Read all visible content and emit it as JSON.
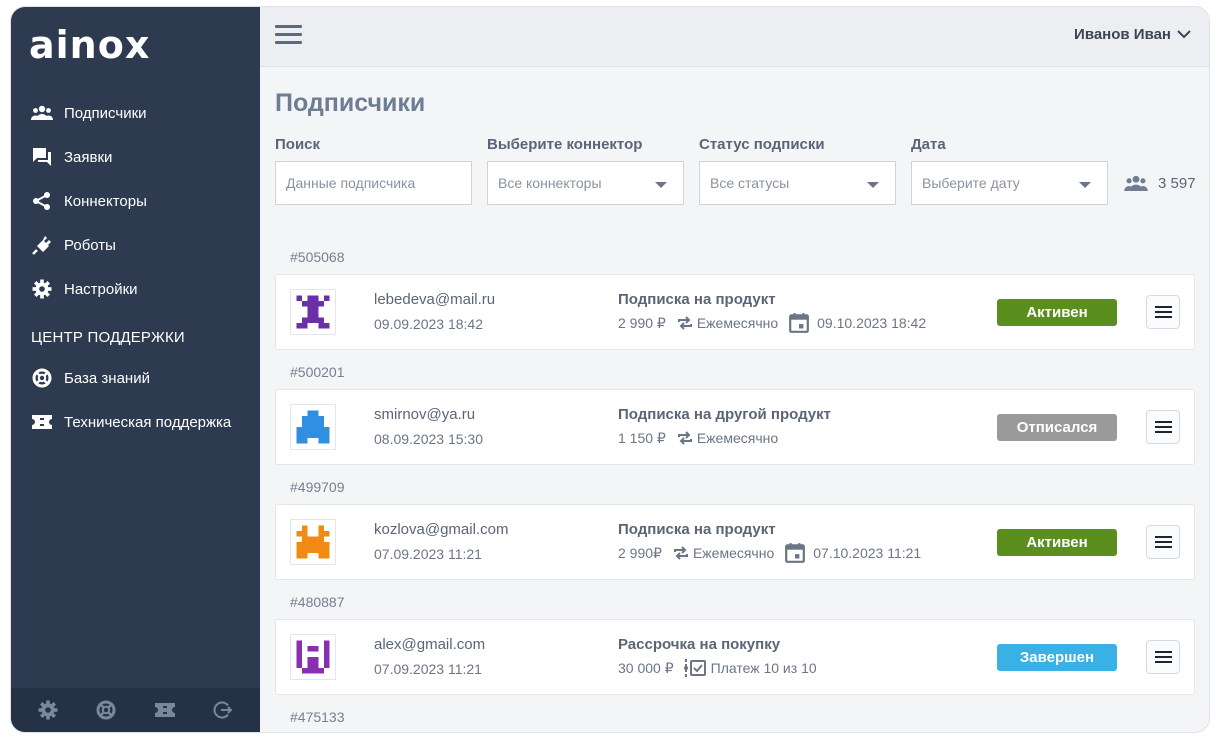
{
  "app": {
    "logo_text": "ainox"
  },
  "sidebar": {
    "items": [
      {
        "label": "Подписчики",
        "icon": "users-icon"
      },
      {
        "label": "Заявки",
        "icon": "chat-icon"
      },
      {
        "label": "Коннекторы",
        "icon": "share-icon"
      },
      {
        "label": "Роботы",
        "icon": "plug-icon"
      },
      {
        "label": "Настройки",
        "icon": "gear-icon"
      }
    ],
    "section_title": "ЦЕНТР ПОДДЕРЖКИ",
    "support_items": [
      {
        "label": "База знаний",
        "icon": "lifebuoy-icon"
      },
      {
        "label": "Техническая поддержка",
        "icon": "ticket-icon"
      }
    ],
    "footer_icons": [
      "gear-icon",
      "lifebuoy-icon",
      "ticket-icon",
      "logout-icon"
    ]
  },
  "header": {
    "user_name": "Иванов Иван"
  },
  "page": {
    "title": "Подписчики"
  },
  "filters": {
    "search": {
      "label": "Поиск",
      "placeholder": "Данные подписчика"
    },
    "connector": {
      "label": "Выберите коннектор",
      "value": "Все коннекторы"
    },
    "status": {
      "label": "Статус подписки",
      "value": "Все статусы"
    },
    "date": {
      "label": "Дата",
      "value": "Выберите дату"
    }
  },
  "total_count": "3 597",
  "colors": {
    "sidebar_bg": "#2d3a4f",
    "status_active": "#5a8f1d",
    "status_unsubscribed": "#9a9a9a",
    "status_completed": "#3ab1e4"
  },
  "subscribers": [
    {
      "id": "#505068",
      "email": "lebedeva@mail.ru",
      "date": "09.09.2023 18:42",
      "product": "Подписка на продукт",
      "price": "2 990 ₽",
      "period": "Ежемесячно",
      "next_date": "09.10.2023 18:42",
      "status": "Активен",
      "status_color": "#5a8f1d",
      "avatar_color": "#6b2fa8"
    },
    {
      "id": "#500201",
      "email": "smirnov@ya.ru",
      "date": "08.09.2023 15:30",
      "product": "Подписка на другой продукт",
      "price": "1 150 ₽",
      "period": "Ежемесячно",
      "next_date": "",
      "status": "Отписался",
      "status_color": "#9a9a9a",
      "avatar_color": "#2f8fe0"
    },
    {
      "id": "#499709",
      "email": "kozlova@gmail.com",
      "date": "07.09.2023 11:21",
      "product": "Подписка на продукт",
      "price": "2 990₽",
      "period": "Ежемесячно",
      "next_date": "07.10.2023 11:21",
      "status": "Активен",
      "status_color": "#5a8f1d",
      "avatar_color": "#f08a12"
    },
    {
      "id": "#480887",
      "email": "alex@gmail.com",
      "date": "07.09.2023 11:21",
      "product": "Рассрочка на  покупку",
      "price": "30 000 ₽",
      "period": "Платеж 10 из 10",
      "next_date": "",
      "status": "Завершен",
      "status_color": "#3ab1e4",
      "avatar_color": "#8a2fb0"
    },
    {
      "id": "#475133"
    }
  ]
}
